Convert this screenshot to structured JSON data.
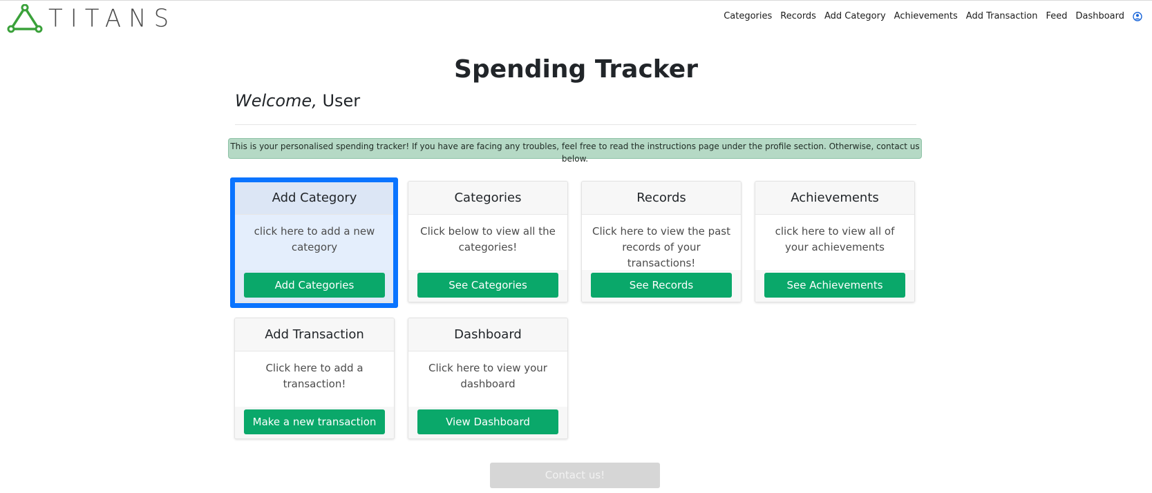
{
  "brand": {
    "name": "TITANS",
    "accent": "#3aa13a"
  },
  "nav": {
    "links": [
      "Categories",
      "Records",
      "Add Category",
      "Achievements",
      "Add Transaction",
      "Feed",
      "Dashboard"
    ],
    "user_icon": "user-circle-icon"
  },
  "page": {
    "title": "Spending Tracker",
    "welcome_em": "Welcome,",
    "welcome_name": " User",
    "alert": "This is your personalised spending tracker! If you have are facing any troubles, feel free to read the instructions page under the profile section. Otherwise, contact us below."
  },
  "cards": [
    {
      "title": "Add Category",
      "text": "click here to add a new category",
      "button": "Add Categories"
    },
    {
      "title": "Categories",
      "text": "Click below to view all the categories!",
      "button": "See Categories"
    },
    {
      "title": "Records",
      "text": "Click here to view the past records of your transactions!",
      "button": "See Records"
    },
    {
      "title": "Achievements",
      "text": "click here to view all of your achievements",
      "button": "See Achievements"
    },
    {
      "title": "Add Transaction",
      "text": "Click here to add a transaction!",
      "button": "Make a new transaction"
    },
    {
      "title": "Dashboard",
      "text": "Click here to view your dashboard",
      "button": "View Dashboard"
    }
  ],
  "contact_button": "Contact us!",
  "colors": {
    "button_green": "#0aa86a",
    "alert_bg": "#b5d9c5",
    "highlight": "#0a74ff",
    "contact_disabled": "#d6d6d6"
  }
}
